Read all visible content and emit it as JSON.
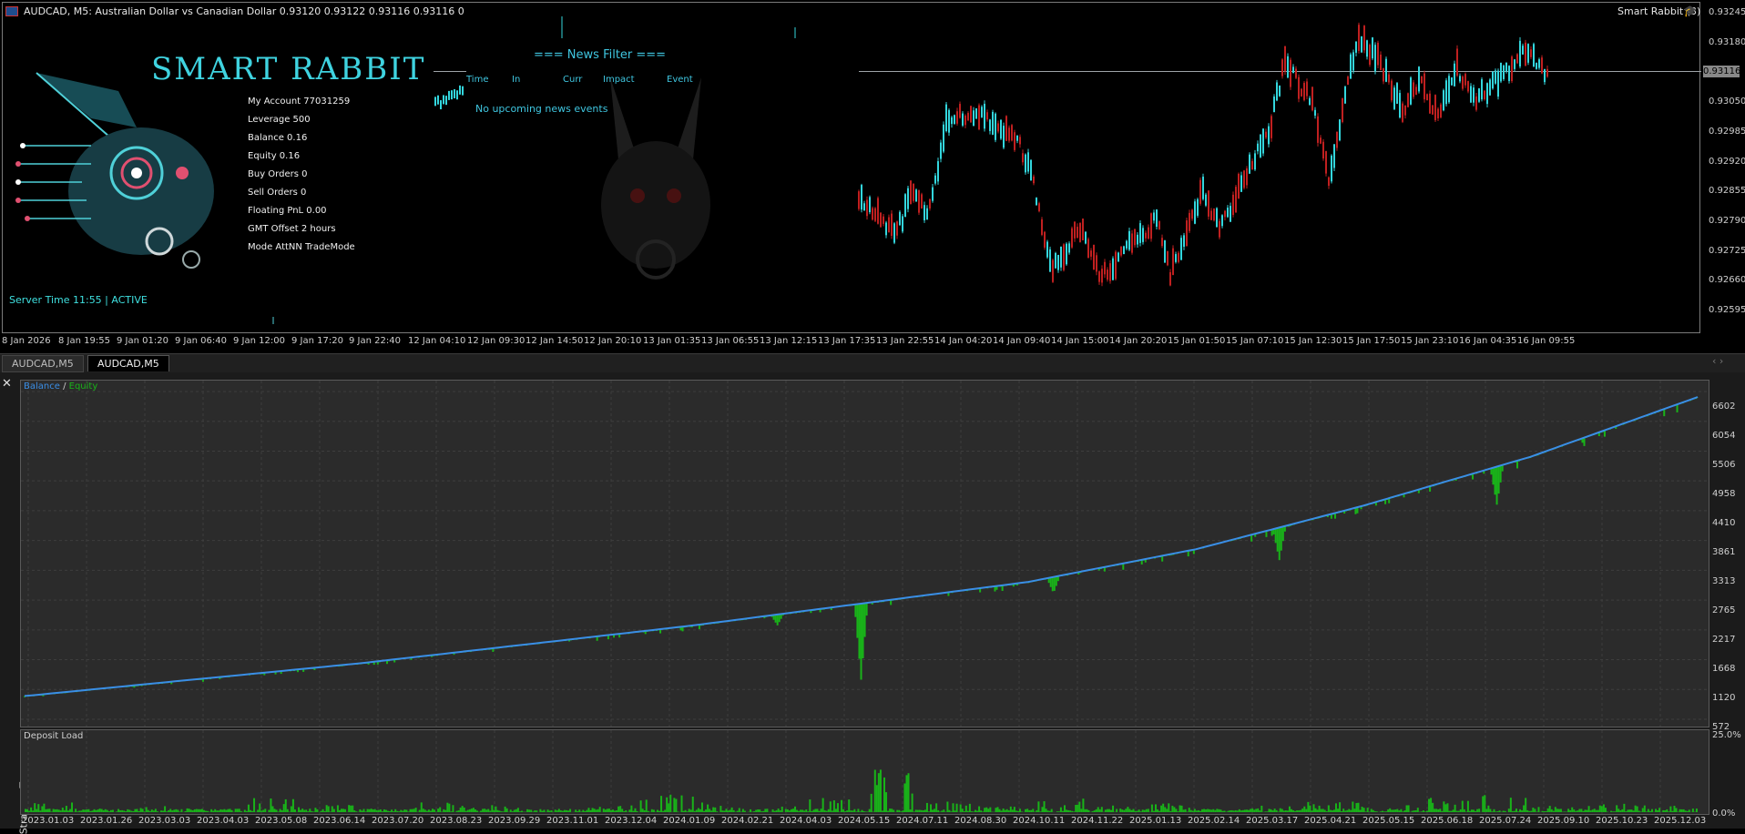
{
  "chart": {
    "symbol_header": "AUDCAD, M5:  Australian Dollar vs Canadian Dollar  0.93120 0.93122 0.93116 0.93116  0",
    "ea_name": "Smart Rabbit (3)",
    "current_price": "0.93116",
    "price_ticks": [
      "0.93245",
      "0.93180",
      "0.93116",
      "0.93050",
      "0.92985",
      "0.92920",
      "0.92855",
      "0.92790",
      "0.92725",
      "0.92660",
      "0.92595"
    ],
    "time_ticks": [
      "8 Jan 2026",
      "8 Jan 19:55",
      "9 Jan 01:20",
      "9 Jan 06:40",
      "9 Jan 12:00",
      "9 Jan 17:20",
      "9 Jan 22:40",
      "12 Jan 04:10",
      "12 Jan 09:30",
      "12 Jan 14:50",
      "12 Jan 20:10",
      "13 Jan 01:35",
      "13 Jan 06:55",
      "13 Jan 12:15",
      "13 Jan 17:35",
      "13 Jan 22:55",
      "14 Jan 04:20",
      "14 Jan 09:40",
      "14 Jan 15:00",
      "14 Jan 20:20",
      "15 Jan 01:50",
      "15 Jan 07:10",
      "15 Jan 12:30",
      "15 Jan 17:50",
      "15 Jan 23:10",
      "16 Jan 04:35",
      "16 Jan 09:55"
    ],
    "colors": {
      "bull": "#33d6dd",
      "bear": "#c02020",
      "grid_line": "#9ea3a8"
    }
  },
  "panel": {
    "logo_title": "SMART  RABBIT",
    "info": [
      "My Account 77031259",
      "Leverage 500",
      "Balance 0.16",
      "Equity 0.16",
      "Buy Orders 0",
      "Sell Orders 0",
      "Floating PnL 0.00",
      "GMT Offset 2 hours",
      "Mode AttNN TradeMode"
    ],
    "server_time": "Server Time 11:55 | ACTIVE"
  },
  "news": {
    "title": "=== News Filter  ===",
    "columns": [
      "Time",
      "In",
      "Curr",
      "Impact",
      "Event"
    ],
    "empty_message": "No upcoming news events"
  },
  "tabs": [
    {
      "label": "AUDCAD,M5",
      "active": false
    },
    {
      "label": "AUDCAD,M5",
      "active": true
    }
  ],
  "tester": {
    "side_label": "Strategy Tester",
    "legend_balance": "Balance",
    "legend_sep": " / ",
    "legend_equity": "Equity",
    "deposit_label": "Deposit Load",
    "y_ticks": [
      "6602",
      "6054",
      "5506",
      "4958",
      "4410",
      "3861",
      "3313",
      "2765",
      "2217",
      "1668",
      "1120",
      "572"
    ],
    "deposit_ticks": [
      "25.0%",
      "0.0%"
    ],
    "x_ticks": [
      "2023.01.03",
      "2023.01.26",
      "2023.03.03",
      "2023.04.03",
      "2023.05.08",
      "2023.06.14",
      "2023.07.20",
      "2023.08.23",
      "2023.09.29",
      "2023.11.01",
      "2023.12.04",
      "2024.01.09",
      "2024.02.21",
      "2024.04.03",
      "2024.05.15",
      "2024.07.11",
      "2024.08.30",
      "2024.10.11",
      "2024.11.22",
      "2025.01.13",
      "2025.02.14",
      "2025.03.17",
      "2025.04.21",
      "2025.05.15",
      "2025.06.18",
      "2025.07.24",
      "2025.09.10",
      "2025.10.23",
      "2025.12.03"
    ],
    "colors": {
      "balance": "#3a8ee6",
      "equity": "#19b319",
      "deposit": "#19b319"
    }
  },
  "chart_data": [
    {
      "type": "line",
      "title": "",
      "series": [
        {
          "name": "Balance",
          "x": [
            0,
            0.1,
            0.2,
            0.3,
            0.4,
            0.5,
            0.6,
            0.7,
            0.8,
            0.9,
            1.0
          ],
          "values": [
            1000,
            1300,
            1600,
            1950,
            2300,
            2700,
            3100,
            3700,
            4500,
            5400,
            6500
          ]
        },
        {
          "name": "Equity",
          "x": [
            0,
            0.1,
            0.2,
            0.3,
            0.4,
            0.5,
            0.52,
            0.6,
            0.7,
            0.8,
            0.88,
            0.9,
            1.0
          ],
          "values": [
            990,
            1290,
            1580,
            1930,
            2280,
            2650,
            1400,
            3050,
            3650,
            4450,
            4700,
            5350,
            6480
          ]
        }
      ],
      "ylim": [
        572,
        6602
      ]
    },
    {
      "type": "bar",
      "title": "Deposit Load",
      "ylim": [
        0,
        25
      ],
      "values": [
        3,
        1,
        2,
        1,
        4,
        2,
        1,
        3,
        2,
        1,
        2,
        5,
        3,
        2,
        4,
        12,
        3,
        2,
        4,
        2,
        3,
        1,
        2,
        3,
        2,
        4,
        5,
        2,
        3,
        2
      ]
    }
  ]
}
